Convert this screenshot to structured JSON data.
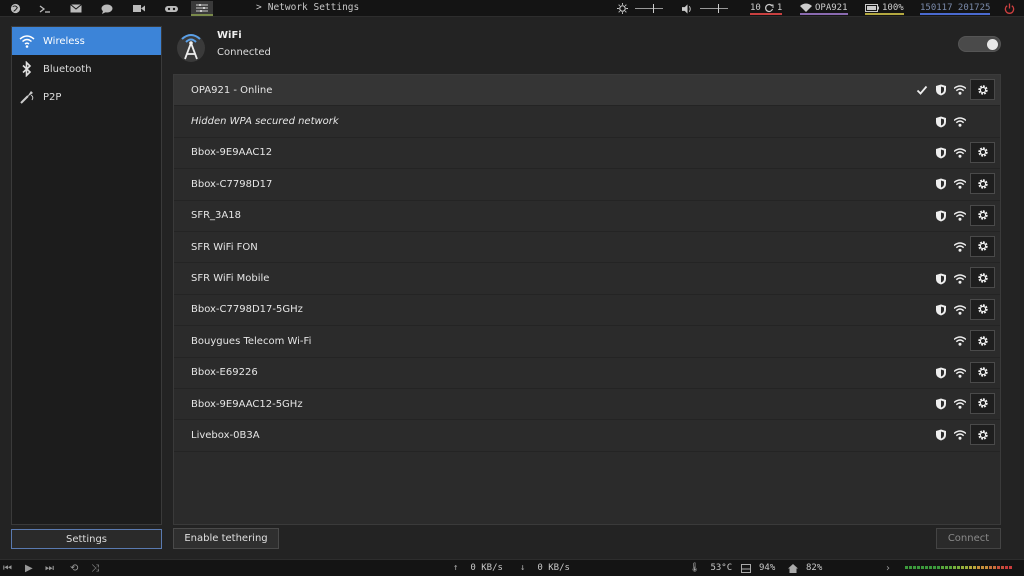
{
  "topbar": {
    "title_arrow": ">",
    "title": "Network Settings",
    "workspaces": "10",
    "refresh_count": "1",
    "network_name": "OPA921",
    "battery": "100%",
    "datetime": "150117 201725"
  },
  "sidebar": {
    "items": [
      {
        "label": "Wireless",
        "icon": "wifi-icon",
        "selected": true
      },
      {
        "label": "Bluetooth",
        "icon": "bluetooth-icon",
        "selected": false
      },
      {
        "label": "P2P",
        "icon": "p2p-icon",
        "selected": false
      }
    ],
    "settings_label": "Settings"
  },
  "header": {
    "title": "WiFi",
    "status": "Connected",
    "toggle_on": true
  },
  "networks": [
    {
      "name": "OPA921 - Online",
      "italic": false,
      "connected": true,
      "secured": true,
      "settings": true
    },
    {
      "name": "Hidden WPA secured network",
      "italic": true,
      "connected": false,
      "secured": true,
      "settings": false
    },
    {
      "name": "Bbox-9E9AAC12",
      "italic": false,
      "connected": false,
      "secured": true,
      "settings": true
    },
    {
      "name": "Bbox-C7798D17",
      "italic": false,
      "connected": false,
      "secured": true,
      "settings": true
    },
    {
      "name": "SFR_3A18",
      "italic": false,
      "connected": false,
      "secured": true,
      "settings": true
    },
    {
      "name": "SFR WiFi FON",
      "italic": false,
      "connected": false,
      "secured": false,
      "settings": true
    },
    {
      "name": "SFR WiFi Mobile",
      "italic": false,
      "connected": false,
      "secured": true,
      "settings": true
    },
    {
      "name": "Bbox-C7798D17-5GHz",
      "italic": false,
      "connected": false,
      "secured": true,
      "settings": true
    },
    {
      "name": "Bouygues Telecom Wi-Fi",
      "italic": false,
      "connected": false,
      "secured": false,
      "settings": true
    },
    {
      "name": "Bbox-E69226",
      "italic": false,
      "connected": false,
      "secured": true,
      "settings": true
    },
    {
      "name": "Bbox-9E9AAC12-5GHz",
      "italic": false,
      "connected": false,
      "secured": true,
      "settings": true
    },
    {
      "name": "Livebox-0B3A",
      "italic": false,
      "connected": false,
      "secured": true,
      "settings": true
    }
  ],
  "buttons": {
    "tether": "Enable tethering",
    "connect": "Connect"
  },
  "statusbar": {
    "upload": "0 KB/s",
    "download": "0 KB/s",
    "temperature": "53°C",
    "disk": "94%",
    "home": "82%"
  },
  "colors": {
    "accent": "#3c84d8",
    "panel": "#141414",
    "background": "#232323"
  }
}
